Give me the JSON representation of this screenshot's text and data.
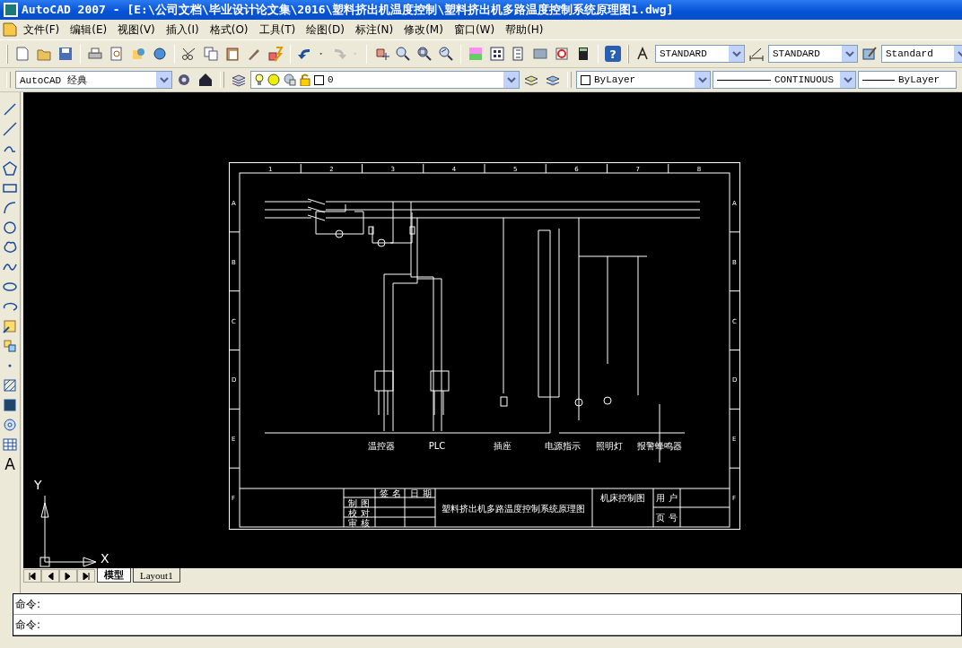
{
  "window": {
    "title": "AutoCAD 2007 - [E:\\公司文档\\毕业设计论文集\\2016\\塑料挤出机温度控制\\塑料挤出机多路温度控制系统原理图1.dwg]"
  },
  "menu": [
    "文件(F)",
    "编辑(E)",
    "视图(V)",
    "插入(I)",
    "格式(O)",
    "工具(T)",
    "绘图(D)",
    "标注(N)",
    "修改(M)",
    "窗口(W)",
    "帮助(H)"
  ],
  "toolbar": {
    "help": "?",
    "text_style": "STANDARD",
    "dim_style": "STANDARD",
    "table_style": "Standard"
  },
  "properties_bar": {
    "workspace": "AutoCAD 经典",
    "layer": "0",
    "color_setting": "ByLayer",
    "linetype": "CONTINUOUS",
    "lineweight": "ByLayer"
  },
  "draw_toolbar": {
    "text_tool": "A"
  },
  "drawing": {
    "columns": [
      "1",
      "2",
      "3",
      "4",
      "5",
      "6",
      "7",
      "8"
    ],
    "rows_left": [
      "A",
      "B",
      "C",
      "D",
      "E",
      "F"
    ],
    "rows_right": [
      "A",
      "B",
      "C",
      "D",
      "E",
      "F"
    ],
    "loads": [
      "温控器",
      "PLC",
      "插座",
      "电源指示",
      "照明灯",
      "报警蜂鸣器"
    ],
    "title_block": {
      "headers": [
        "签 名",
        "日 期"
      ],
      "roles": [
        "制 图",
        "校 对",
        "审 核"
      ],
      "title": "塑料挤出机多路温度控制系统原理图",
      "drawing_type": "机床控制图",
      "client": "用 户",
      "number": "页 号"
    }
  },
  "ucs": {
    "x": "X",
    "y": "Y"
  },
  "layout_tabs": [
    {
      "label": "模型",
      "selected": true
    },
    {
      "label": "Layout1",
      "selected": false
    }
  ],
  "command_lines": [
    "命令:",
    "命令:"
  ]
}
